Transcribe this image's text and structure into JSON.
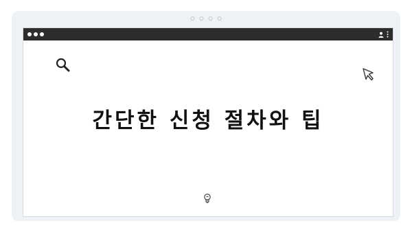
{
  "window": {
    "control_icons": [
      "dot",
      "dot",
      "dot"
    ],
    "bar_icons": [
      "user-icon",
      "kebab-menu-icon"
    ]
  },
  "carousel": {
    "indicator_count": 4
  },
  "slide": {
    "title": "간단한 신청 절차와 팁",
    "icons": [
      "search-icon",
      "cursor-icon",
      "lightbulb-icon"
    ]
  },
  "colors": {
    "page_background": "#ffffff",
    "card_background": "#eef1f5",
    "titlebar": "#2d2d2d",
    "text": "#111111"
  }
}
